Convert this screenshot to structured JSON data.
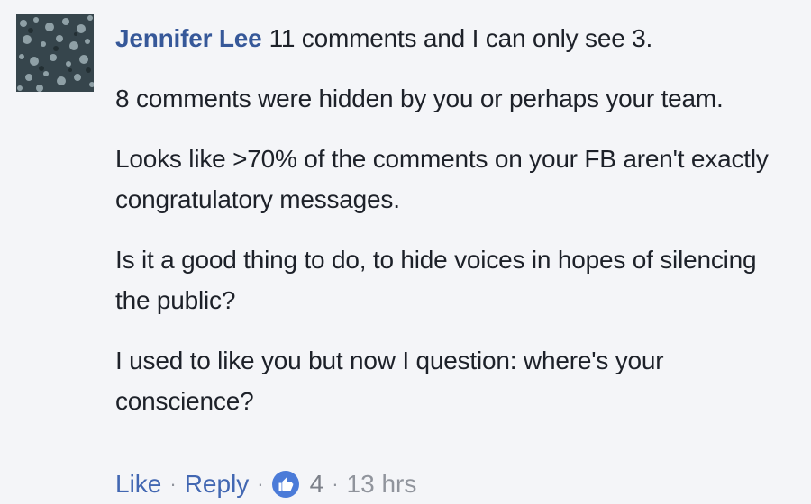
{
  "comment": {
    "author": "Jennifer Lee",
    "paragraphs": [
      "11 comments and I can only see 3.",
      "8 comments were hidden by you or perhaps your team.",
      "Looks like >70% of the comments on your FB aren't exactly congratulatory messages.",
      "Is it a good thing to do, to hide voices in hopes of silencing the public?",
      "I used to like you but now I question: where's your conscience?"
    ],
    "actions": {
      "like_label": "Like",
      "reply_label": "Reply",
      "separator": "·",
      "like_count": "4",
      "timestamp": "13 hrs"
    },
    "reaction_icon": "thumbs-up-icon",
    "colors": {
      "author": "#365899",
      "link": "#4267b2",
      "meta": "#90949c",
      "like_badge": "#4b7bd8",
      "background": "#f4f5f8"
    }
  }
}
